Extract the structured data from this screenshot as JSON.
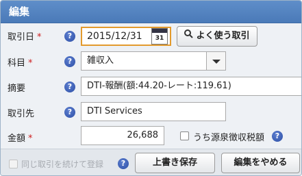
{
  "dialog": {
    "title": "編集"
  },
  "fields": {
    "date": {
      "label": "取引日",
      "required_mark": "*",
      "value": "2015/12/31",
      "calendar_day": "31"
    },
    "quick_button": {
      "label": "よく使う取引"
    },
    "account": {
      "label": "科目",
      "required_mark": "*",
      "value": "雑収入"
    },
    "memo": {
      "label": "摘要",
      "value": "DTI-報酬(額:44.20-レート:119.61)"
    },
    "partner": {
      "label": "取引先",
      "value": "DTI Services"
    },
    "amount": {
      "label": "金額",
      "required_mark": "*",
      "value": "26,688"
    },
    "withholding": {
      "label": "うち源泉徴収税額",
      "checked": false
    }
  },
  "footer": {
    "continue_label": "同じ取引を続けて登録",
    "save_label": "上書き保存",
    "cancel_label": "編集をやめる"
  },
  "help_glyph": "?",
  "colors": {
    "title_bar": "#4a7ab8",
    "required": "#cc1e1e",
    "focus_border": "#e39a2c",
    "help_icon": "#2d4fa6"
  },
  "icons": [
    "help-icon",
    "calendar-icon",
    "search-icon",
    "dropdown-arrow-icon",
    "checkbox-icon"
  ]
}
